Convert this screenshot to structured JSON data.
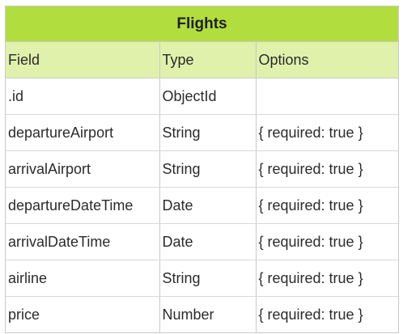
{
  "table": {
    "title": "Flights",
    "headers": [
      "Field",
      "Type",
      "Options"
    ],
    "rows": [
      {
        "field": ".id",
        "type": "ObjectId",
        "options": ""
      },
      {
        "field": "departureAirport",
        "type": "String",
        "options": "{ required: true }"
      },
      {
        "field": "arrivalAirport",
        "type": "String",
        "options": "{ required: true }"
      },
      {
        "field": "departureDateTime",
        "type": "Date",
        "options": "{ required: true }"
      },
      {
        "field": "arrivalDateTime",
        "type": "Date",
        "options": "{ required: true }"
      },
      {
        "field": "airline",
        "type": "String",
        "options": "{ required: true }"
      },
      {
        "field": "price",
        "type": "Number",
        "options": "{ required: true }"
      }
    ]
  },
  "colors": {
    "title_bg": "#b2dd3f",
    "header_bg": "#dff1ab",
    "border": "#c9c9c9"
  }
}
